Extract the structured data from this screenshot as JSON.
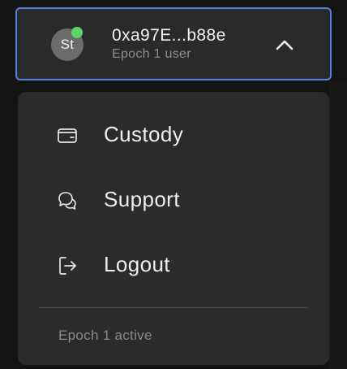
{
  "account": {
    "avatar_initials": "St",
    "online_color": "#5bd463",
    "address": "0xa97E...b88e",
    "subtitle": "Epoch 1 user",
    "chevron_icon": "chevron-up-icon",
    "border_color": "#5b7fd4"
  },
  "menu": {
    "items": [
      {
        "label": "Custody",
        "icon": "wallet-icon"
      },
      {
        "label": "Support",
        "icon": "chat-bubbles-icon"
      },
      {
        "label": "Logout",
        "icon": "logout-icon"
      }
    ],
    "footer": "Epoch 1 active"
  }
}
